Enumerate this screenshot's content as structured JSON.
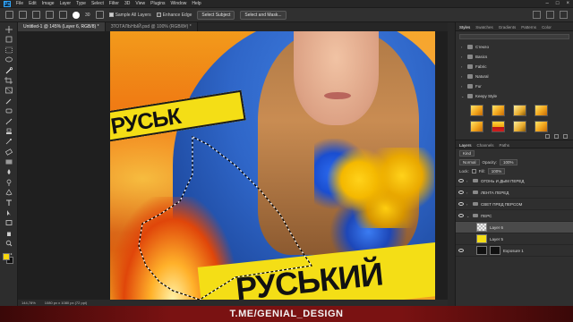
{
  "menu": {
    "items": [
      "File",
      "Edit",
      "Image",
      "Layer",
      "Type",
      "Select",
      "Filter",
      "3D",
      "View",
      "Plugins",
      "Window",
      "Help"
    ]
  },
  "options": {
    "brush_size": "30",
    "sample_all_layers": "Sample All Layers",
    "enhance_edge": "Enhance Edge",
    "select_subject": "Select Subject",
    "select_and_mask": "Select and Mask..."
  },
  "tabs": [
    {
      "label": "Untitled-1 @ 145% (Layer 6, RGB/8) *",
      "active": true
    },
    {
      "label": "ЗТОТАЛЬНЫЙ.psd @ 100% (RGB/8#) *",
      "active": false
    }
  ],
  "canvas": {
    "tape_top_text": "РУСЬК",
    "tape_bottom_text": "РУСЬКИЙ"
  },
  "status": {
    "zoom": "144,78%",
    "doc_size": "1080 px x 1080 px (72 ppi)"
  },
  "watermark": "T.ME/GENIAL_DESIGN",
  "styles_panel": {
    "tabs": [
      "Styles",
      "Swatches",
      "Gradients",
      "Patterns",
      "Color"
    ],
    "groups": [
      "Стекло",
      "Basics",
      "Fabric",
      "Natural",
      "Fur",
      "Keepy Style"
    ],
    "swatch_kinds": [
      "gold",
      "gold",
      "dark",
      "gold",
      "gold",
      "red",
      "dark",
      "gold"
    ]
  },
  "layers_panel": {
    "tabs": [
      "Layers",
      "Channels",
      "Paths"
    ],
    "filter_kind": "Kind",
    "blend_mode": "Normal",
    "opacity_label": "Opacity:",
    "opacity_value": "100%",
    "lock_label": "Lock:",
    "fill_label": "Fill:",
    "fill_value": "100%",
    "layers": [
      {
        "name": "ОГОНЬ И ДЫМ ПЕРЕД",
        "type": "group",
        "visible": true,
        "selected": false
      },
      {
        "name": "ЛЕНТА ПЕРЕД",
        "type": "group",
        "visible": true,
        "selected": false
      },
      {
        "name": "СВЕТ ПРЕД ПЕРСОМ",
        "type": "group",
        "visible": true,
        "selected": false
      },
      {
        "name": "ПЕРС",
        "type": "group",
        "visible": true,
        "selected": false
      },
      {
        "name": "Layer 6",
        "type": "layer",
        "visible": false,
        "selected": true
      },
      {
        "name": "Layer 5",
        "type": "layer",
        "visible": false,
        "selected": false
      },
      {
        "name": "Exposure 1",
        "type": "adjustment",
        "visible": true,
        "selected": false
      }
    ]
  },
  "colors": {
    "foreground": "#f7d70d",
    "background": "#111111",
    "tape": "#f4de16",
    "hood": "#2f66c8",
    "watermark_band": "#7a1212"
  }
}
